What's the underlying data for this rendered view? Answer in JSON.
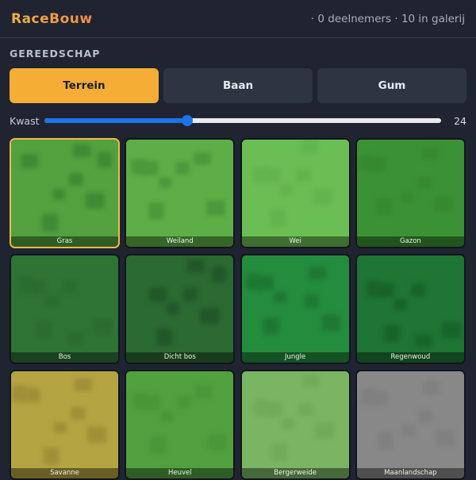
{
  "app": {
    "brand": "RaceBouw",
    "stats": "· 0 deelnemers · 10 in galerij"
  },
  "toolbox": {
    "title": "GEREEDSCHAP",
    "tools": [
      {
        "label": "Terrein",
        "active": true
      },
      {
        "label": "Baan",
        "active": false
      },
      {
        "label": "Gum",
        "active": false
      }
    ]
  },
  "brush": {
    "label": "Kwast",
    "value": "24",
    "fraction": 0.36
  },
  "terrains": [
    {
      "label": "Gras",
      "color": "#54a13f",
      "spot": "#3f8a34",
      "selected": true
    },
    {
      "label": "Weiland",
      "color": "#5eae48",
      "spot": "#4c983c",
      "selected": false
    },
    {
      "label": "Wei",
      "color": "#6bbe53",
      "spot": "#62b44c",
      "selected": false
    },
    {
      "label": "Gazon",
      "color": "#3b9234",
      "spot": "#37892f",
      "selected": false
    },
    {
      "label": "Bos",
      "color": "#2f7434",
      "spot": "#2b6c30",
      "selected": false
    },
    {
      "label": "Dicht bos",
      "color": "#2b6a31",
      "spot": "#22572a",
      "selected": false
    },
    {
      "label": "Jungle",
      "color": "#248c3d",
      "spot": "#1e7833",
      "selected": false
    },
    {
      "label": "Regenwoud",
      "color": "#1f7534",
      "spot": "#19632b",
      "selected": false
    },
    {
      "label": "Savanne",
      "color": "#b5a442",
      "spot": "#a08f38",
      "selected": false
    },
    {
      "label": "Heuvel",
      "color": "#51a03f",
      "spot": "#4a963a",
      "selected": false
    },
    {
      "label": "Bergerweide",
      "color": "#7ab564",
      "spot": "#70ab5a",
      "selected": false
    },
    {
      "label": "Maanlandschap",
      "color": "#888888",
      "spot": "#808080",
      "selected": false
    }
  ]
}
